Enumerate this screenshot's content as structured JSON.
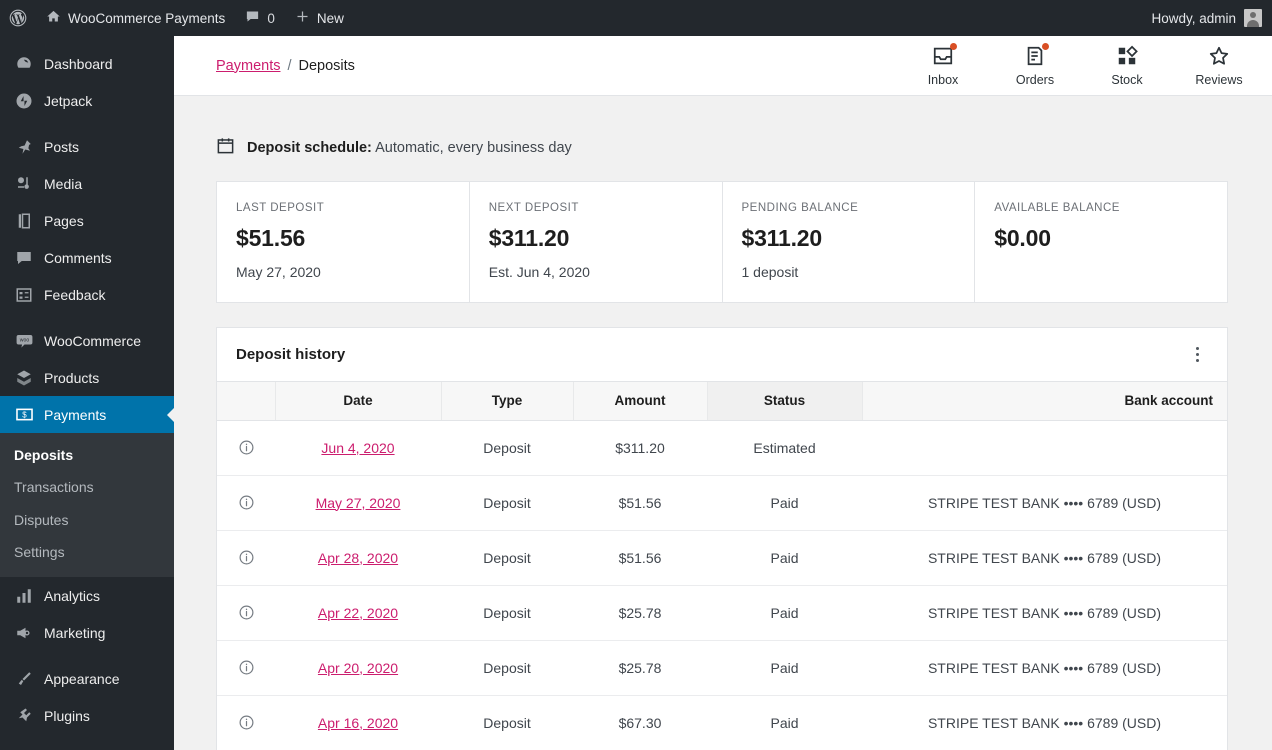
{
  "adminbar": {
    "wp_logo": "wordpress-logo",
    "site_name": "WooCommerce Payments",
    "comment_count": "0",
    "new_label": "New",
    "howdy": "Howdy, admin"
  },
  "sidebar": {
    "items": [
      {
        "label": "Dashboard",
        "icon": "dashboard-icon",
        "sep_after": false
      },
      {
        "label": "Jetpack",
        "icon": "jetpack-icon",
        "sep_after": true
      },
      {
        "label": "Posts",
        "icon": "pin-icon",
        "sep_after": false
      },
      {
        "label": "Media",
        "icon": "media-icon",
        "sep_after": false
      },
      {
        "label": "Pages",
        "icon": "pages-icon",
        "sep_after": false
      },
      {
        "label": "Comments",
        "icon": "comments-icon",
        "sep_after": false
      },
      {
        "label": "Feedback",
        "icon": "feedback-icon",
        "sep_after": true
      },
      {
        "label": "WooCommerce",
        "icon": "woocommerce-icon",
        "sep_after": false
      },
      {
        "label": "Products",
        "icon": "products-icon",
        "sep_after": false
      }
    ],
    "active": {
      "label": "Payments",
      "icon": "payments-icon"
    },
    "submenu": [
      {
        "label": "Deposits",
        "current": true
      },
      {
        "label": "Transactions",
        "current": false
      },
      {
        "label": "Disputes",
        "current": false
      },
      {
        "label": "Settings",
        "current": false
      }
    ],
    "items_after": [
      {
        "label": "Analytics",
        "icon": "analytics-icon",
        "sep_after": false
      },
      {
        "label": "Marketing",
        "icon": "marketing-icon",
        "sep_after": true
      },
      {
        "label": "Appearance",
        "icon": "appearance-icon",
        "sep_after": false
      },
      {
        "label": "Plugins",
        "icon": "plugins-icon",
        "sep_after": false
      }
    ],
    "accent_active": "#0073aa",
    "bg": "#23282d",
    "submenu_bg": "#32373c"
  },
  "topbar": {
    "breadcrumb_link": "Payments",
    "breadcrumb_sep": "/",
    "breadcrumb_current": "Deposits",
    "actions": [
      {
        "label": "Inbox",
        "icon": "inbox-icon",
        "badge": true
      },
      {
        "label": "Orders",
        "icon": "orders-icon",
        "badge": true
      },
      {
        "label": "Stock",
        "icon": "stock-icon",
        "badge": false
      },
      {
        "label": "Reviews",
        "icon": "star-icon",
        "badge": false
      }
    ],
    "badge_color": "#d94f24"
  },
  "schedule": {
    "icon": "calendar-icon",
    "label": "Deposit schedule:",
    "value": "Automatic, every business day"
  },
  "summary": [
    {
      "label": "LAST DEPOSIT",
      "value": "$51.56",
      "sub": "May 27, 2020"
    },
    {
      "label": "NEXT DEPOSIT",
      "value": "$311.20",
      "sub": "Est. Jun 4, 2020"
    },
    {
      "label": "PENDING BALANCE",
      "value": "$311.20",
      "sub": "1 deposit"
    },
    {
      "label": "AVAILABLE BALANCE",
      "value": "$0.00",
      "sub": ""
    }
  ],
  "history": {
    "title": "Deposit history",
    "menu_icon": "kebab-menu-icon",
    "columns": [
      "Date",
      "Type",
      "Amount",
      "Status",
      "Bank account"
    ],
    "sorted_column": "Status",
    "rows": [
      {
        "info": "info-icon",
        "date": "Jun 4, 2020",
        "type": "Deposit",
        "amount": "$311.20",
        "status": "Estimated",
        "bank": ""
      },
      {
        "info": "info-icon",
        "date": "May 27, 2020",
        "type": "Deposit",
        "amount": "$51.56",
        "status": "Paid",
        "bank": "STRIPE TEST BANK •••• 6789 (USD)"
      },
      {
        "info": "info-icon",
        "date": "Apr 28, 2020",
        "type": "Deposit",
        "amount": "$51.56",
        "status": "Paid",
        "bank": "STRIPE TEST BANK •••• 6789 (USD)"
      },
      {
        "info": "info-icon",
        "date": "Apr 22, 2020",
        "type": "Deposit",
        "amount": "$25.78",
        "status": "Paid",
        "bank": "STRIPE TEST BANK •••• 6789 (USD)"
      },
      {
        "info": "info-icon",
        "date": "Apr 20, 2020",
        "type": "Deposit",
        "amount": "$25.78",
        "status": "Paid",
        "bank": "STRIPE TEST BANK •••• 6789 (USD)"
      },
      {
        "info": "info-icon",
        "date": "Apr 16, 2020",
        "type": "Deposit",
        "amount": "$67.30",
        "status": "Paid",
        "bank": "STRIPE TEST BANK •••• 6789 (USD)"
      }
    ],
    "link_color": "#cc1d6e"
  }
}
